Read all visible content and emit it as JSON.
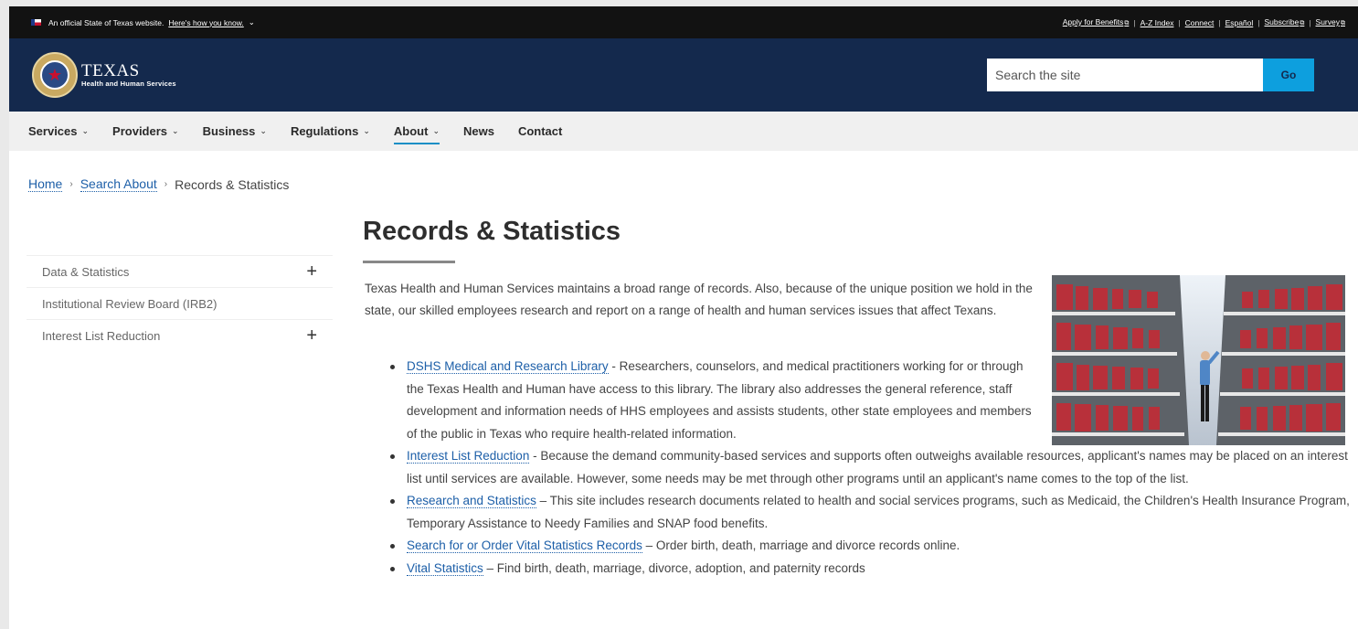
{
  "topbar": {
    "official_text": "An official State of Texas website.",
    "how_you_know": "Here's how you know.",
    "links": [
      "Apply for Benefits",
      "A-Z Index",
      "Connect",
      "Español",
      "Subscribe",
      "Survey"
    ]
  },
  "header": {
    "brand_main": "TEXAS",
    "brand_sub": "Health and Human Services",
    "search_placeholder": "Search the site",
    "search_button": "Go"
  },
  "nav": {
    "items": [
      "Services",
      "Providers",
      "Business",
      "Regulations",
      "About",
      "News",
      "Contact"
    ],
    "active": "About"
  },
  "breadcrumb": {
    "home": "Home",
    "search_about": "Search About",
    "current": "Records & Statistics"
  },
  "sidebar": {
    "items": [
      "Data & Statistics",
      "Institutional Review Board (IRB2)",
      "Interest List Reduction"
    ]
  },
  "main": {
    "title": "Records & Statistics",
    "intro": "Texas Health and Human Services maintains a broad range of records. Also, because of the unique position we hold in the state, our skilled employees research and report on a range of health and human services issues that affect Texans.",
    "items": [
      {
        "link": "DSHS Medical and Research Library",
        "text": " - Researchers, counselors, and medical practitioners working for or through the Texas Health and Human have access to this library. The library also addresses the general reference, staff development and information needs of HHS employees and assists students, other state employees and members of the public in Texas who require health-related information."
      },
      {
        "link": "Interest List Reduction",
        "text": " - Because the demand community-based services and supports often outweighs available resources, applicant's names may be placed on an interest list until services are available. However, some needs may be met through other programs until an applicant's name comes to the top of the list."
      },
      {
        "link": "Research and Statistics",
        "text": " – This site includes research documents related to health and social services programs, such as Medicaid, the Children's Health Insurance Program, Temporary Assistance to Needy Families and SNAP food benefits."
      },
      {
        "link": "Search for or Order Vital Statistics Records",
        "text": " – Order birth, death, marriage and divorce records online."
      },
      {
        "link": "Vital Statistics",
        "text": " – Find birth, death, marriage, divorce, adoption, and paternity records"
      }
    ]
  },
  "colors": {
    "header_bg": "#14294d",
    "topbar_bg": "#121212",
    "go_button": "#0d9fde",
    "link": "#1d5fa8",
    "active_underline": "#1a8fc6"
  }
}
